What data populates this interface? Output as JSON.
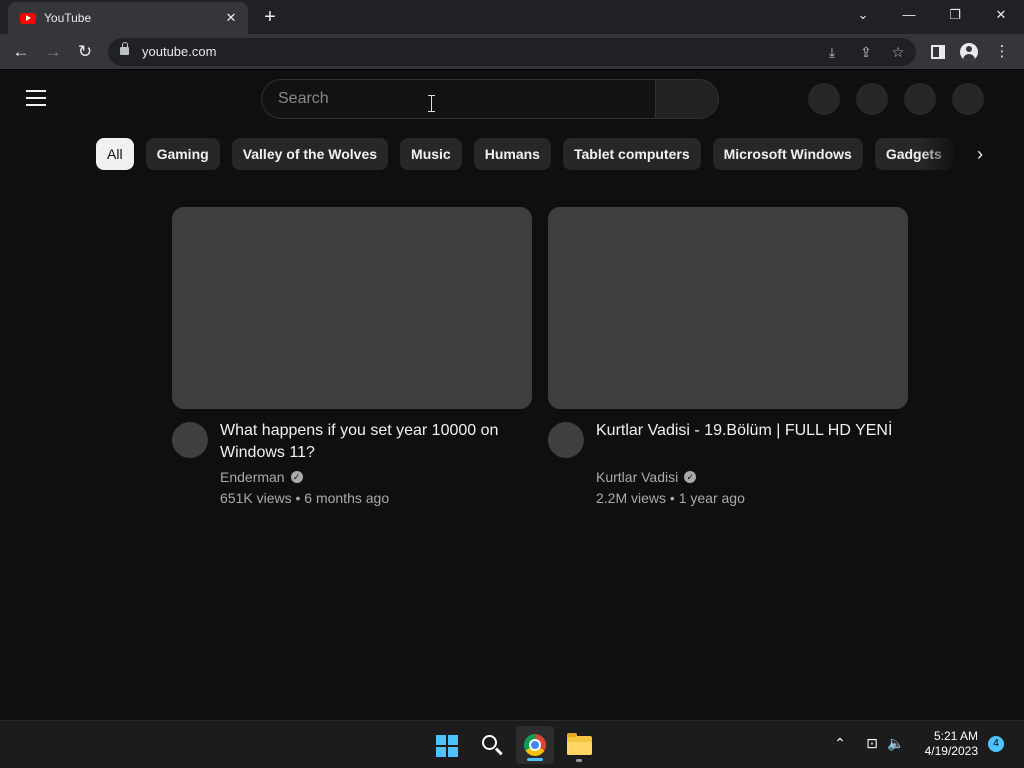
{
  "browser": {
    "tab_title": "YouTube",
    "tab_close": "✕",
    "new_tab": "+",
    "url": "youtube.com",
    "window_controls": {
      "dropdown": "⌄",
      "minimize": "—",
      "restore": "❐",
      "close": "✕"
    }
  },
  "toolbar": {
    "back": "←",
    "forward": "→",
    "reload": "↻",
    "install": "⤓",
    "share": "⇪",
    "bookmark": "☆",
    "menu": "⋮"
  },
  "youtube": {
    "search": {
      "placeholder": "Search"
    },
    "chips": [
      "All",
      "Gaming",
      "Valley of the Wolves",
      "Music",
      "Humans",
      "Tablet computers",
      "Microsoft Windows",
      "Gadgets"
    ],
    "chip_next": "›",
    "videos": [
      {
        "title": "What happens if you set year 10000 on Windows 11?",
        "channel": "Enderman",
        "verified": "✓",
        "meta": "651K views • 6 months ago"
      },
      {
        "title": "Kurtlar Vadisi - 19.Bölüm | FULL HD YENİ",
        "channel": "Kurtlar Vadisi",
        "verified": "✓",
        "meta": "2.2M views • 1 year ago"
      }
    ]
  },
  "taskbar": {
    "tray": {
      "chevron": "⌃",
      "network": "⊡",
      "volume": "🔈"
    },
    "time": "5:21 AM",
    "date": "4/19/2023",
    "notifications": "4"
  },
  "colors": {
    "accent": "#4cc2ff",
    "youtube_red": "#ff0000",
    "page_bg": "#0f0f0f"
  }
}
